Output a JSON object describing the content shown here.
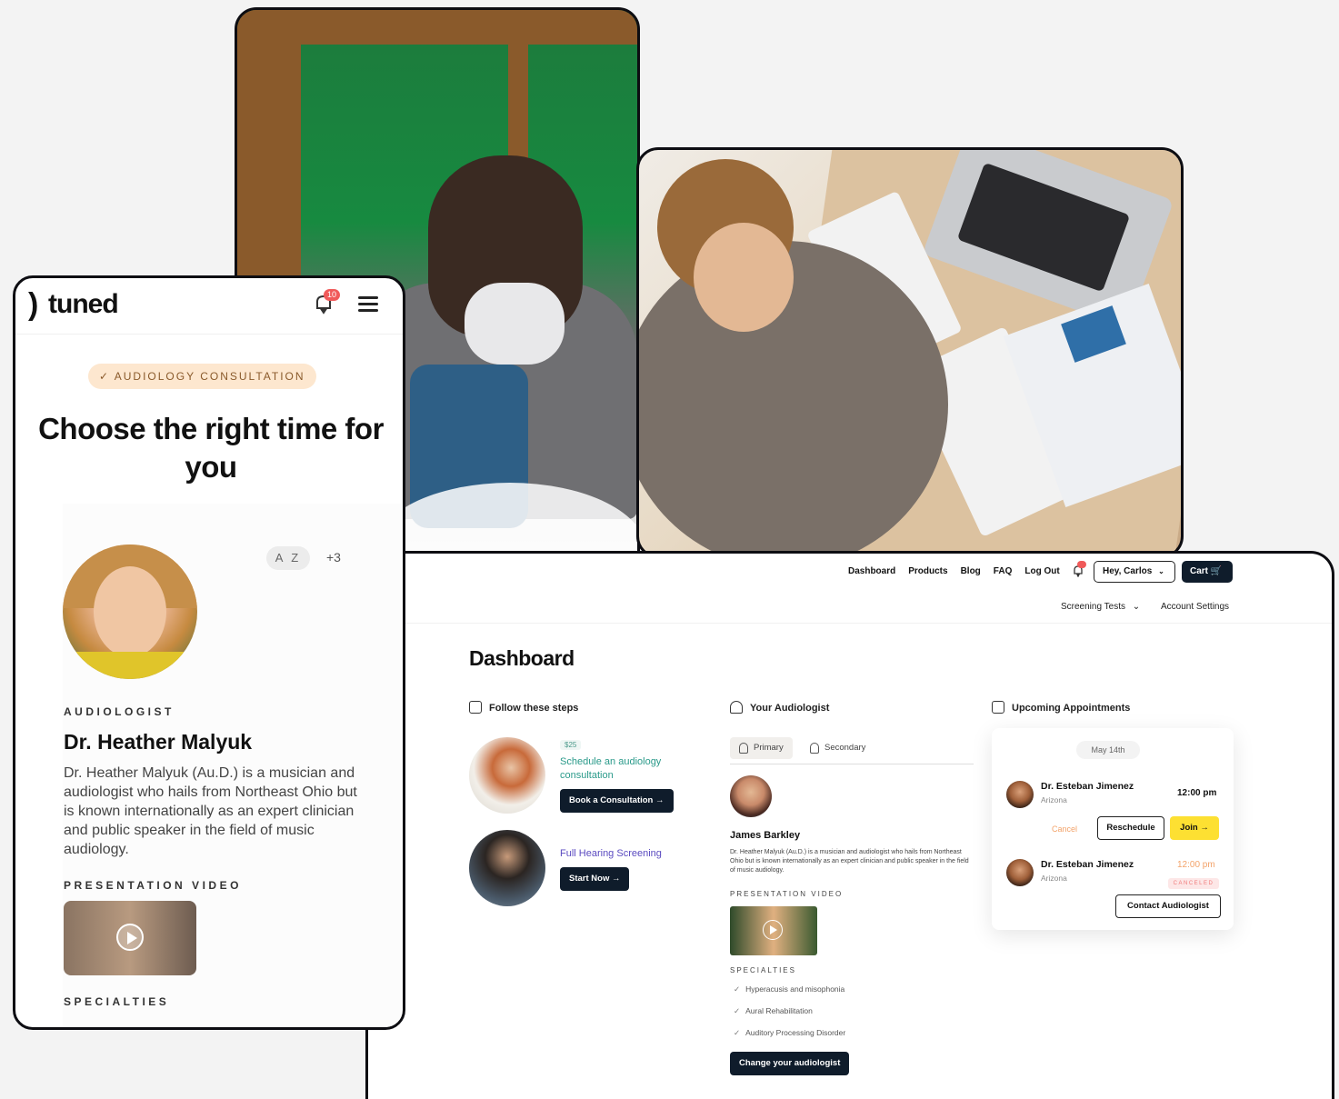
{
  "mobile": {
    "logo": "tuned",
    "notification_count": "10",
    "pill": "✓ AUDIOLOGY CONSULTATION",
    "title": "Choose the right time for you",
    "state_badge": "A Z",
    "more_badge": "+3",
    "role_label": "AUDIOLOGIST",
    "name": "Dr. Heather Malyuk",
    "bio": "Dr. Heather Malyuk (Au.D.) is a musician and audiologist who hails from Northeast Ohio but is known internationally as an expert clinician and public speaker in the field of music audiology.",
    "video_label": "PRESENTATION VIDEO",
    "specialties_label": "SPECIALTIES"
  },
  "desktop": {
    "nav": [
      "Dashboard",
      "Products",
      "Blog",
      "FAQ",
      "Log Out"
    ],
    "greeting": "Hey, Carlos",
    "cart": "Cart",
    "subnav": [
      "Screening Tests",
      "Account Settings"
    ],
    "title": "Dashboard",
    "steps": {
      "heading": "Follow these steps",
      "items": [
        {
          "price": "$25",
          "label": "Schedule an audiology consultation",
          "button": "Book a Consultation"
        },
        {
          "label": "Full Hearing Screening",
          "button": "Start Now"
        }
      ]
    },
    "audiologist": {
      "heading": "Your Audiologist",
      "tabs": [
        "Primary",
        "Secondary"
      ],
      "name": "James Barkley",
      "bio": "Dr. Heather Malyuk (Au.D.) is a musician and audiologist who hails from Northeast Ohio but is known internationally as an expert clinician and public speaker in the field of music audiology.",
      "video_label": "PRESENTATION VIDEO",
      "specialties_label": "SPECIALTIES",
      "specialties": [
        "Hyperacusis and misophonia",
        "Aural Rehabilitation",
        "Auditory Processing Disorder"
      ],
      "change_button": "Change your audiologist"
    },
    "appointments": {
      "heading": "Upcoming Appointments",
      "date": "May 14th",
      "items": [
        {
          "doctor": "Dr. Esteban Jimenez",
          "location": "Arizona",
          "time": "12:00 pm",
          "cancel": "Cancel",
          "reschedule": "Reschedule",
          "join": "Join"
        },
        {
          "doctor": "Dr. Esteban Jimenez",
          "location": "Arizona",
          "time": "12:00 pm",
          "status": "CANCELED"
        }
      ],
      "contact_button": "Contact Audiologist"
    }
  },
  "colors": {
    "dark": "#0f1c2b",
    "accent_yellow": "#fde032",
    "pill_bg": "#fde7cf",
    "teal": "#2a9a8a",
    "purple": "#5a4ac0",
    "alert": "#f05a5a"
  }
}
